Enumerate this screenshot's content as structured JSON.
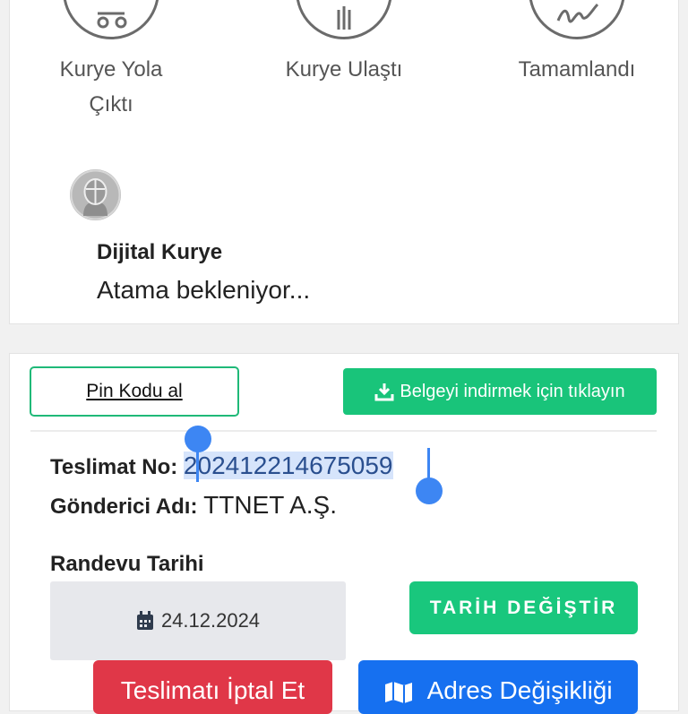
{
  "steps": [
    {
      "line1": "Kurye Yola",
      "line2": "Çıktı",
      "icon": "scooter-icon"
    },
    {
      "line1": "Kurye Ulaştı",
      "icon": "fork-icon"
    },
    {
      "line1": "Tamamlandı",
      "icon": "signature-icon"
    }
  ],
  "courier": {
    "name": "Dijital Kurye",
    "status": "Atama bekleniyor..."
  },
  "actions": {
    "pin_label": "Pin Kodu al",
    "download_label": "Belgeyi indirmek için tıklayın"
  },
  "delivery": {
    "no_label": "Teslimat No",
    "no_value": "202412214675059",
    "sender_label": "Gönderici Adı",
    "sender_value": "TTNET A.Ş."
  },
  "appointment": {
    "label": "Randevu Tarihi",
    "date": "24.12.2024",
    "change_label": "TARİH DEĞİŞTİR"
  },
  "bottom_buttons": {
    "cancel_label": "Teslimatı İptal Et",
    "address_label": "Adres Değişikliği"
  },
  "colors": {
    "primary_green": "#19c47a",
    "cancel_red": "#e03748",
    "address_blue": "#1670f0",
    "selection_blue": "#3d86f3"
  }
}
